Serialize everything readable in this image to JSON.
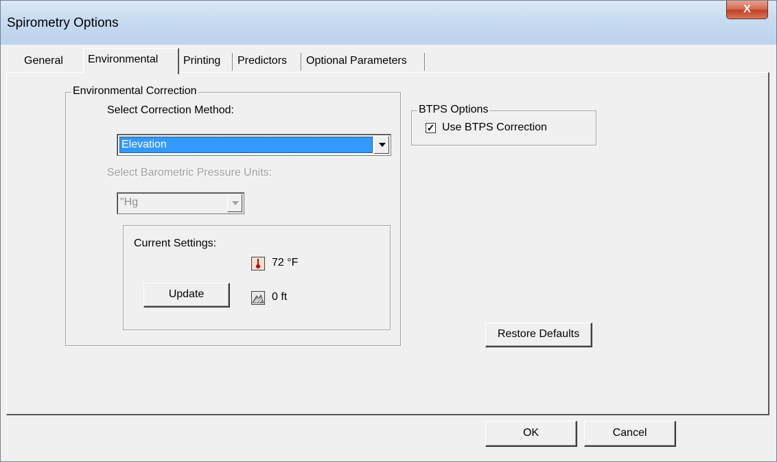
{
  "window": {
    "title": "Spirometry Options",
    "close_label": "X"
  },
  "tabs": [
    {
      "label": "General"
    },
    {
      "label": "Environmental"
    },
    {
      "label": "Printing"
    },
    {
      "label": "Predictors"
    },
    {
      "label": "Optional Parameters"
    }
  ],
  "environmental": {
    "group_title": "Environmental Correction",
    "method_label": "Select Correction Method:",
    "method_value": "Elevation",
    "pressure_label": "Select Barometric Pressure Units:",
    "pressure_value": "\"Hg",
    "current_settings_label": "Current Settings:",
    "temperature": "72 °F",
    "elevation": "0 ft",
    "update_label": "Update"
  },
  "btps": {
    "group_title": "BTPS Options",
    "checkbox_label": "Use BTPS Correction",
    "checked": true,
    "check_mark": "✓"
  },
  "buttons": {
    "restore_defaults": "Restore Defaults",
    "ok": "OK",
    "cancel": "Cancel"
  },
  "icons": {
    "thermometer": "thermometer-icon",
    "elevation": "elevation-icon"
  },
  "colors": {
    "selection": "#3399ff",
    "close_button": "#c24127",
    "title_bar": "#c7dbf1"
  }
}
